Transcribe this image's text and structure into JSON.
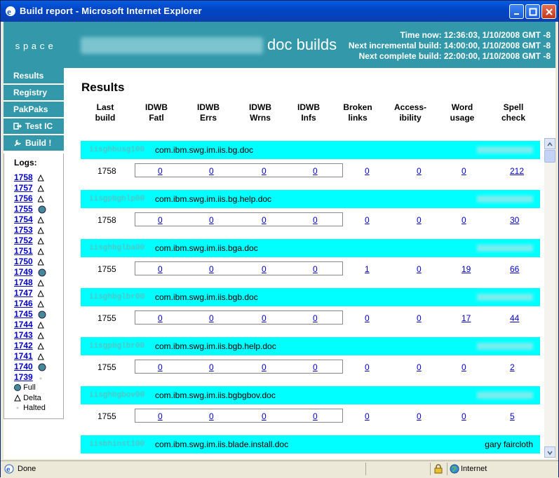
{
  "window": {
    "title": "Build report - Microsoft Internet Explorer"
  },
  "header": {
    "brand": "space",
    "heading": "doc builds",
    "time_now": "Time now: 12:36:03, 1/10/2008 GMT -8",
    "next_incremental": "Next incremental build: 14:00:00, 1/10/2008 GMT -8",
    "next_complete": "Next complete build: 22:00:00, 1/10/2008 GMT -8"
  },
  "nav": {
    "results": "Results",
    "registry": "Registry",
    "pakpaks": "PakPaks",
    "test_ic": "Test IC",
    "build": "Build !"
  },
  "logs": {
    "title": "Logs:",
    "items": [
      {
        "num": "1758",
        "kind": "delta"
      },
      {
        "num": "1757",
        "kind": "delta"
      },
      {
        "num": "1756",
        "kind": "delta"
      },
      {
        "num": "1755",
        "kind": "full"
      },
      {
        "num": "1754",
        "kind": "delta"
      },
      {
        "num": "1753",
        "kind": "delta"
      },
      {
        "num": "1752",
        "kind": "delta"
      },
      {
        "num": "1751",
        "kind": "delta"
      },
      {
        "num": "1750",
        "kind": "delta"
      },
      {
        "num": "1749",
        "kind": "full"
      },
      {
        "num": "1748",
        "kind": "delta"
      },
      {
        "num": "1747",
        "kind": "delta"
      },
      {
        "num": "1746",
        "kind": "delta"
      },
      {
        "num": "1745",
        "kind": "full"
      },
      {
        "num": "1744",
        "kind": "delta"
      },
      {
        "num": "1743",
        "kind": "delta"
      },
      {
        "num": "1742",
        "kind": "delta"
      },
      {
        "num": "1741",
        "kind": "delta"
      },
      {
        "num": "1740",
        "kind": "full"
      },
      {
        "num": "1739",
        "kind": "halted"
      }
    ],
    "legend": {
      "full": "Full",
      "delta": "Delta",
      "halted": "Halted"
    }
  },
  "results": {
    "title": "Results",
    "columns": [
      {
        "l1": "Last",
        "l2": "build"
      },
      {
        "l1": "IDWB",
        "l2": "Fatl"
      },
      {
        "l1": "IDWB",
        "l2": "Errs"
      },
      {
        "l1": "IDWB",
        "l2": "Wrns"
      },
      {
        "l1": "IDWB",
        "l2": "Infs"
      },
      {
        "l1": "Broken",
        "l2": "links"
      },
      {
        "l1": "Access-",
        "l2": "ibility"
      },
      {
        "l1": "Word",
        "l2": "usage"
      },
      {
        "l1": "Spell",
        "l2": "check"
      }
    ],
    "rows": [
      {
        "id": "iisghbusg100",
        "pkg": "com.ibm.swg.im.iis.bg.doc",
        "owner": "",
        "build": "1758",
        "vals": [
          "0",
          "0",
          "0",
          "0",
          "0",
          "0",
          "0",
          "212"
        ]
      },
      {
        "id": "iisgpbghlp00",
        "pkg": "com.ibm.swg.im.iis.bg.help.doc",
        "owner": "",
        "build": "1758",
        "vals": [
          "0",
          "0",
          "0",
          "0",
          "0",
          "0",
          "0",
          "30"
        ]
      },
      {
        "id": "iisghbglba00",
        "pkg": "com.ibm.swg.im.iis.bga.doc",
        "owner": "",
        "build": "1755",
        "vals": [
          "0",
          "0",
          "0",
          "0",
          "1",
          "0",
          "19",
          "66"
        ]
      },
      {
        "id": "iisghbglbr00",
        "pkg": "com.ibm.swg.im.iis.bgb.doc",
        "owner": "",
        "build": "1755",
        "vals": [
          "0",
          "0",
          "0",
          "0",
          "0",
          "0",
          "17",
          "44"
        ]
      },
      {
        "id": "iisgpbglbr00",
        "pkg": "com.ibm.swg.im.iis.bgb.help.doc",
        "owner": "",
        "build": "1755",
        "vals": [
          "0",
          "0",
          "0",
          "0",
          "0",
          "0",
          "0",
          "2"
        ]
      },
      {
        "id": "iisghbgbov00",
        "pkg": "com.ibm.swg.im.iis.bgbgbov.doc",
        "owner": "",
        "build": "1755",
        "vals": [
          "0",
          "0",
          "0",
          "0",
          "0",
          "0",
          "0",
          "5"
        ]
      },
      {
        "id": "iisbhinst100",
        "pkg": "com.ibm.swg.im.iis.blade.install.doc",
        "owner": "gary faircloth",
        "build": "",
        "vals": []
      }
    ]
  },
  "status": {
    "text": "Done",
    "zone": "Internet"
  },
  "colors": {
    "header": "#3399aa",
    "row_head": "#00ffff",
    "link": "#0000cc"
  }
}
